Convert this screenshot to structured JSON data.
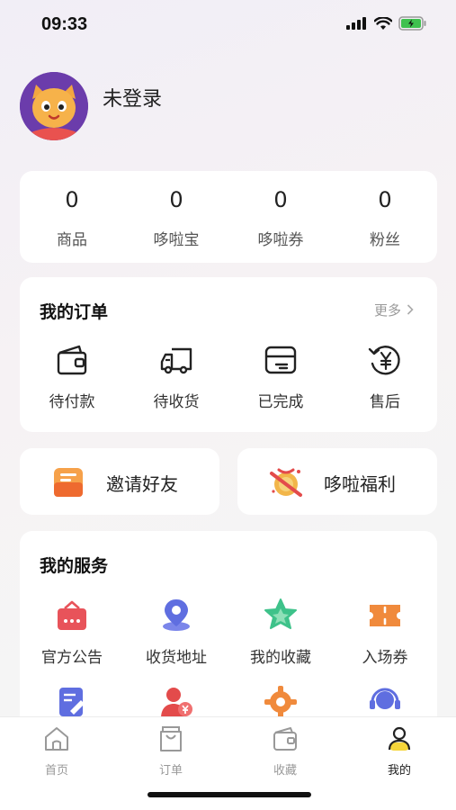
{
  "status_bar": {
    "time": "09:33"
  },
  "profile": {
    "name": "未登录"
  },
  "stats": [
    {
      "value": "0",
      "label": "商品"
    },
    {
      "value": "0",
      "label": "哆啦宝"
    },
    {
      "value": "0",
      "label": "哆啦券"
    },
    {
      "value": "0",
      "label": "粉丝"
    }
  ],
  "orders": {
    "title": "我的订单",
    "more": "更多",
    "items": [
      {
        "label": "待付款",
        "icon": "wallet-icon"
      },
      {
        "label": "待收货",
        "icon": "truck-icon"
      },
      {
        "label": "已完成",
        "icon": "box-icon"
      },
      {
        "label": "售后",
        "icon": "refund-icon"
      }
    ]
  },
  "promos": [
    {
      "label": "邀请好友",
      "icon": "mail-icon"
    },
    {
      "label": "哆啦福利",
      "icon": "gift-icon"
    }
  ],
  "services": {
    "title": "我的服务",
    "items": [
      {
        "label": "官方公告",
        "icon": "notice-bag-icon"
      },
      {
        "label": "收货地址",
        "icon": "location-icon"
      },
      {
        "label": "我的收藏",
        "icon": "star-icon"
      },
      {
        "label": "入场券",
        "icon": "ticket-icon"
      }
    ]
  },
  "tabbar": [
    {
      "label": "首页",
      "icon": "home-icon"
    },
    {
      "label": "订单",
      "icon": "bag-icon"
    },
    {
      "label": "收藏",
      "icon": "wallet-icon"
    },
    {
      "label": "我的",
      "icon": "user-icon"
    }
  ],
  "colors": {
    "accent_yellow": "#f5d53a",
    "notice_red": "#e8535a",
    "location_blue": "#5f6ee0",
    "star_green": "#3ec28a",
    "ticket_orange": "#f08a3c"
  }
}
